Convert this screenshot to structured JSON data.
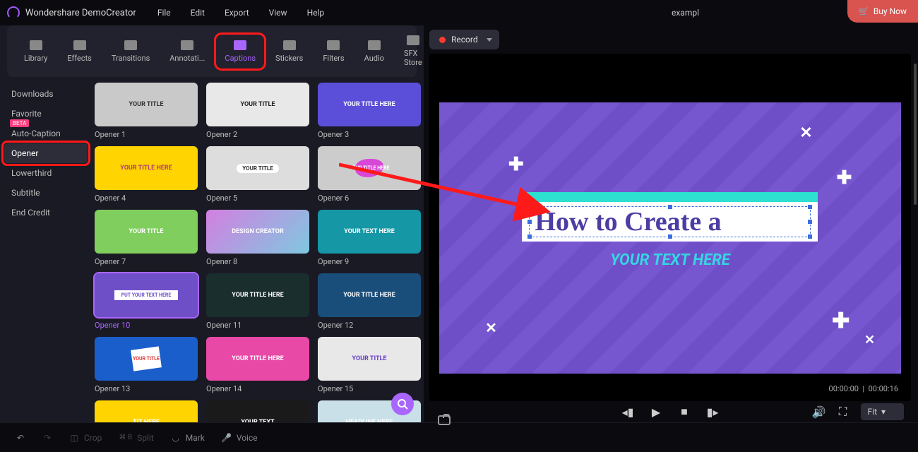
{
  "app": {
    "name": "Wondershare DemoCreator",
    "project": "exampl"
  },
  "menu": [
    "File",
    "Edit",
    "Export",
    "View",
    "Help"
  ],
  "buy_now": "Buy Now",
  "tool_tabs": [
    {
      "id": "library",
      "label": "Library"
    },
    {
      "id": "effects",
      "label": "Effects"
    },
    {
      "id": "transitions",
      "label": "Transitions"
    },
    {
      "id": "annotations",
      "label": "Annotati..."
    },
    {
      "id": "captions",
      "label": "Captions",
      "active": true,
      "highlighted": true
    },
    {
      "id": "stickers",
      "label": "Stickers"
    },
    {
      "id": "filters",
      "label": "Filters"
    },
    {
      "id": "audio",
      "label": "Audio"
    },
    {
      "id": "sfx",
      "label": "SFX Store"
    }
  ],
  "sidebar": [
    {
      "id": "downloads",
      "label": "Downloads"
    },
    {
      "id": "favorite",
      "label": "Favorite"
    },
    {
      "id": "auto-caption",
      "label": "Auto-Caption",
      "beta": "BETA"
    },
    {
      "id": "opener",
      "label": "Opener",
      "active": true,
      "highlighted": true
    },
    {
      "id": "lowerthird",
      "label": "Lowerthird"
    },
    {
      "id": "subtitle",
      "label": "Subtitle"
    },
    {
      "id": "end-credit",
      "label": "End Credit"
    }
  ],
  "thumbs": [
    {
      "label": "Opener 1",
      "cls": "t1",
      "txt": "YOUR TITLE"
    },
    {
      "label": "Opener 2",
      "cls": "t2",
      "txt": "YOUR TITLE"
    },
    {
      "label": "Opener 3",
      "cls": "t3",
      "txt": "YOUR TITLE HERE"
    },
    {
      "label": "Opener 4",
      "cls": "t4",
      "txt": "YOUR TITLE HERE"
    },
    {
      "label": "Opener 5",
      "cls": "t5",
      "txt": "YOUR TITLE",
      "pill": true
    },
    {
      "label": "Opener 6",
      "cls": "t6",
      "txt": "YOUR TITLE HERE",
      "blob": true
    },
    {
      "label": "Opener 7",
      "cls": "t7",
      "txt": "YOUR TITLE"
    },
    {
      "label": "Opener 8",
      "cls": "t8",
      "txt": "DESIGN CREATOR"
    },
    {
      "label": "Opener 9",
      "cls": "t9",
      "txt": "YOUR TEXT HERE"
    },
    {
      "label": "Opener 10",
      "cls": "t10",
      "txt": "PUT YOUR TEXT HERE",
      "selected": true,
      "bar": true
    },
    {
      "label": "Opener 11",
      "cls": "t11",
      "txt": "YOUR TITLE HERE"
    },
    {
      "label": "Opener 12",
      "cls": "t12",
      "txt": "YOUR TITLE HERE"
    },
    {
      "label": "Opener 13",
      "cls": "t13",
      "txt": "YOUR TITLE",
      "brush": true
    },
    {
      "label": "Opener 14",
      "cls": "t14",
      "txt": "YOUR TITLE HERE"
    },
    {
      "label": "Opener 15",
      "cls": "t15",
      "txt": "YOUR TITLE"
    },
    {
      "label": "",
      "cls": "t16",
      "txt": "TIT HERE"
    },
    {
      "label": "",
      "cls": "t17",
      "txt": "YOUR TEXT"
    },
    {
      "label": "",
      "cls": "t18",
      "txt": "HEADLINE HERE"
    }
  ],
  "record": {
    "label": "Record"
  },
  "preview": {
    "title": "How to Create a",
    "subtitle": "YOUR TEXT HERE",
    "time_current": "00:00:00",
    "time_total": "00:00:16"
  },
  "fit_label": "Fit",
  "bottom": {
    "crop": "Crop",
    "split": "Split",
    "mark": "Mark",
    "voice": "Voice",
    "split_shortcut": "⌘ B"
  }
}
